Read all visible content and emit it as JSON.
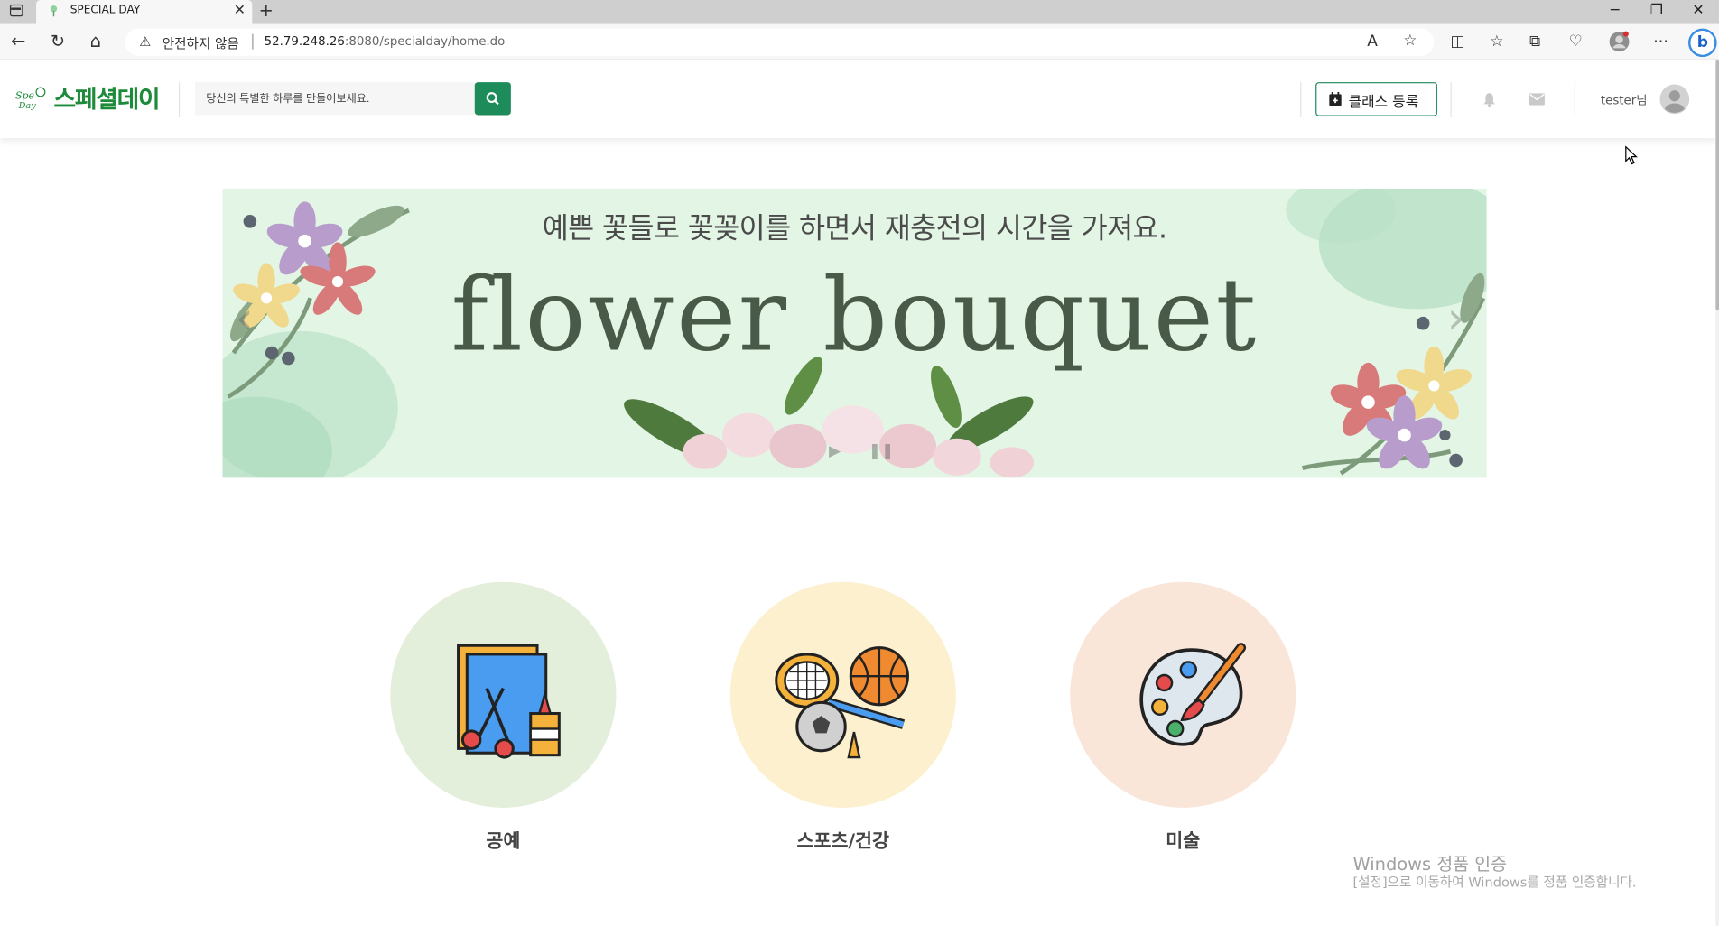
{
  "browser": {
    "tab_title": "SPECIAL DAY",
    "new_tab_icon": "plus-icon",
    "security_label": "안전하지 않음",
    "url_host": "52.79.248.26",
    "url_rest": ":8080/specialday/home.do"
  },
  "header": {
    "logo_text": "스페셜데이",
    "search_placeholder": "당신의 특별한 하루를 만들어보세요.",
    "class_register_label": "클래스 등록",
    "username": "tester님"
  },
  "banner": {
    "subtitle": "예쁜 꽃들로 꽃꽂이를 하면서 재충전의 시간을 가져요.",
    "title": "flower bouquet"
  },
  "categories": [
    {
      "label": "공예",
      "bg": "#e3eedb",
      "icon": "craft-icon"
    },
    {
      "label": "스포츠/건강",
      "bg": "#fdf0ce",
      "icon": "sports-icon"
    },
    {
      "label": "미술",
      "bg": "#fae6d9",
      "icon": "art-palette-icon"
    }
  ],
  "watermark": {
    "title": "Windows 정품 인증",
    "subtitle": "[설정]으로 이동하여 Windows를 정품 인증합니다."
  },
  "colors": {
    "brand_green": "#1d8b3a",
    "button_green": "#1d8b5a",
    "banner_bg": "#e3f5e5"
  }
}
